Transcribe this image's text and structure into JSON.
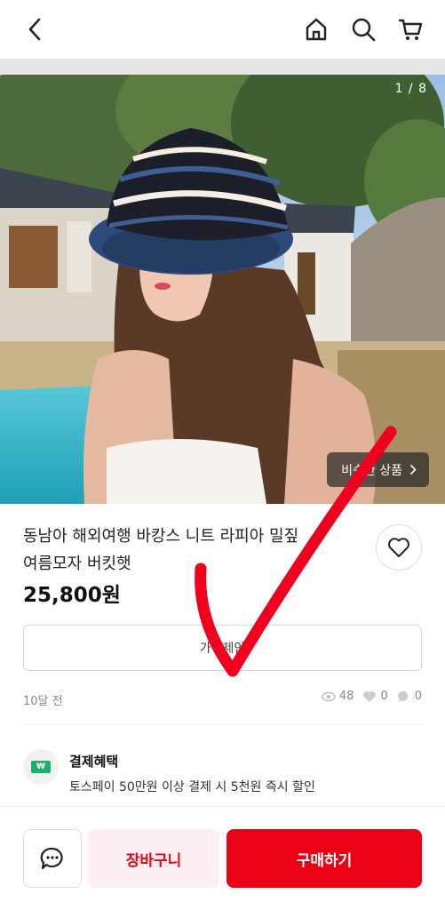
{
  "header": {
    "back_icon": "chevron-left-icon",
    "home_icon": "home-icon",
    "search_icon": "search-icon",
    "cart_icon": "cart-icon"
  },
  "gallery": {
    "counter": "1 / 8",
    "similar_label": "비슷한 상품"
  },
  "product": {
    "title_line1": "동남아 해외여행 바캉스 니트 라피아 밀짚",
    "title_line2": "여름모자 버킷햇",
    "price": "25,800원"
  },
  "offer_button_label": "가격제안",
  "meta": {
    "posted": "10달 전",
    "views": "48",
    "likes": "0",
    "chats": "0"
  },
  "benefit": {
    "badge": "₩",
    "title": "결제혜택",
    "description": "토스페이 50만원 이상 결제 시 5천원 즉시 할인"
  },
  "bottom_bar": {
    "cart_label": "장바구니",
    "buy_label": "구매하기"
  },
  "colors": {
    "accent": "#e90315",
    "accent_light": "#fdeff1",
    "benefit_green": "#1db06a",
    "checkmark": "#f0001e"
  }
}
